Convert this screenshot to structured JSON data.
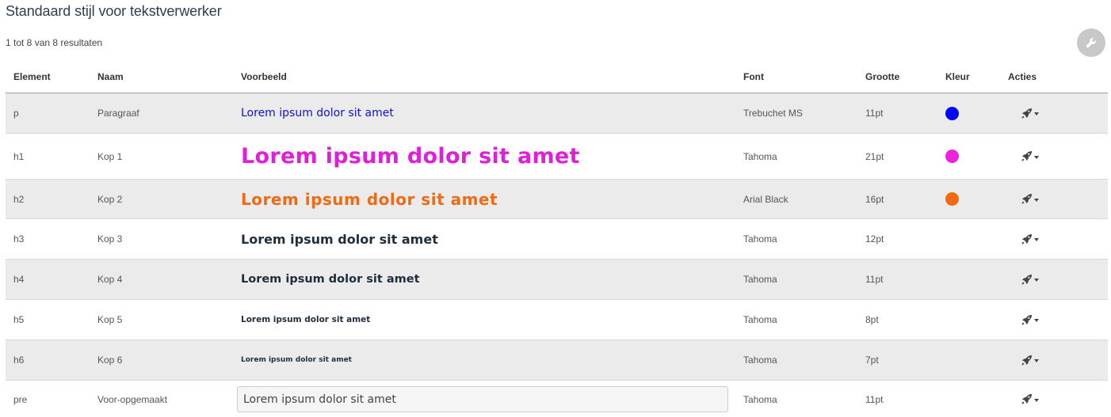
{
  "header": {
    "title": "Standaard stijl voor tekstverwerker",
    "result_count": "1 tot 8 van 8 resultaten",
    "wrench_icon": "wrench-icon"
  },
  "table": {
    "columns": [
      "Element",
      "Naam",
      "Voorbeeld",
      "Font",
      "Grootte",
      "Kleur",
      "Acties"
    ],
    "rows": [
      {
        "element": "p",
        "name": "Paragraaf",
        "example": "Lorem ipsum dolor sit amet",
        "font": "Trebuchet MS",
        "size": "11pt",
        "color": "#0000ff"
      },
      {
        "element": "h1",
        "name": "Kop 1",
        "example": "Lorem ipsum dolor sit amet",
        "font": "Tahoma",
        "size": "21pt",
        "color": "#ee22dd"
      },
      {
        "element": "h2",
        "name": "Kop 2",
        "example": "Lorem ipsum dolor sit amet",
        "font": "Arial Black",
        "size": "16pt",
        "color": "#f26a10"
      },
      {
        "element": "h3",
        "name": "Kop 3",
        "example": "Lorem ipsum dolor sit amet",
        "font": "Tahoma",
        "size": "12pt",
        "color": ""
      },
      {
        "element": "h4",
        "name": "Kop 4",
        "example": "Lorem ipsum dolor sit amet",
        "font": "Tahoma",
        "size": "11pt",
        "color": ""
      },
      {
        "element": "h5",
        "name": "Kop 5",
        "example": "Lorem ipsum dolor sit amet",
        "font": "Tahoma",
        "size": "8pt",
        "color": ""
      },
      {
        "element": "h6",
        "name": "Kop 6",
        "example": "Lorem ipsum dolor sit amet",
        "font": "Tahoma",
        "size": "7pt",
        "color": ""
      },
      {
        "element": "pre",
        "name": "Voor-opgemaakt",
        "example": "Lorem ipsum dolor sit amet",
        "font": "Tahoma",
        "size": "11pt",
        "color": ""
      }
    ],
    "action_icon": "rocket-icon"
  }
}
